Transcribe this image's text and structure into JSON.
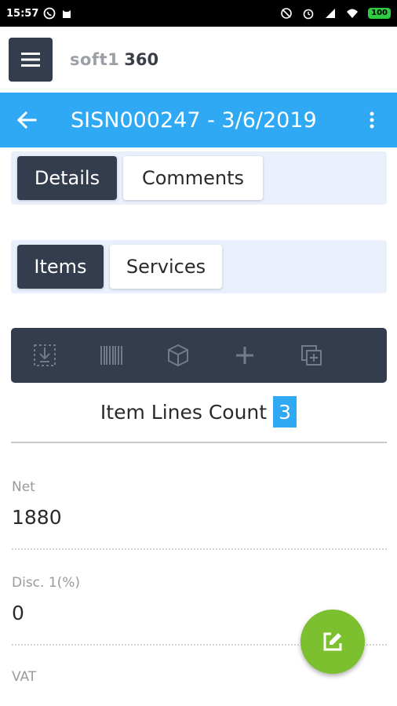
{
  "status_bar": {
    "time": "15:57",
    "battery": "100",
    "icons": [
      "viber-icon",
      "cat-icon",
      "dnd-icon",
      "alarm-icon",
      "signal-icon",
      "wifi-icon"
    ]
  },
  "app": {
    "brand_prefix": "soft1",
    "brand_suffix": "360"
  },
  "header": {
    "title": "SISN000247 - 3/6/2019"
  },
  "tabs_top": [
    {
      "label": "Details",
      "active": true
    },
    {
      "label": "Comments",
      "active": false
    }
  ],
  "tabs_sub": [
    {
      "label": "Items",
      "active": true
    },
    {
      "label": "Services",
      "active": false
    }
  ],
  "toolbar": {
    "icons": [
      "import-icon",
      "barcode-icon",
      "package-icon",
      "add-icon",
      "duplicate-icon"
    ]
  },
  "item_lines": {
    "label": "Item Lines Count",
    "count": "3"
  },
  "fields": [
    {
      "label": "Net",
      "value": "1880"
    },
    {
      "label": "Disc. 1(%)",
      "value": "0"
    },
    {
      "label": "VAT",
      "value": ""
    }
  ],
  "colors": {
    "accent": "#2fa9f4",
    "dark": "#343d4e",
    "fab": "#7cc02f",
    "tab_bg": "#e9effb"
  }
}
